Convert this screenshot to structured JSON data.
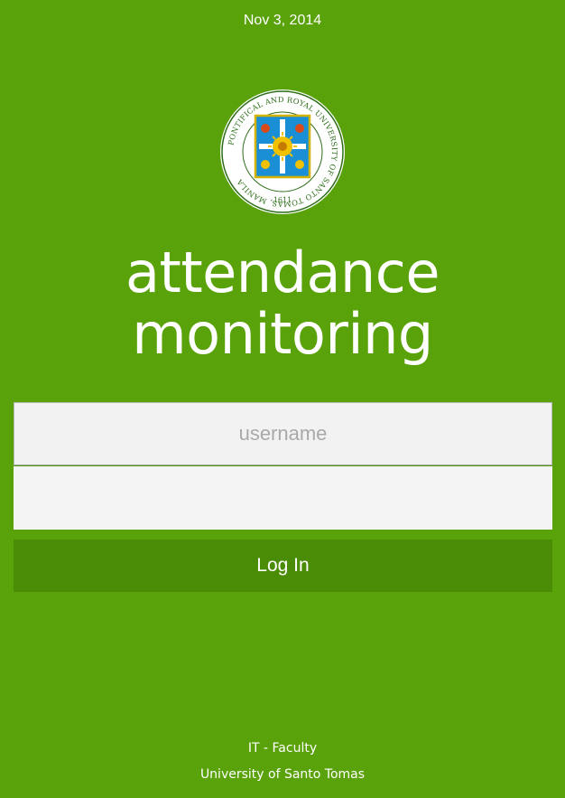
{
  "header": {
    "date": "Nov 3, 2014"
  },
  "seal": {
    "icon": "university-seal-icon",
    "ring_text": "PONTIFICAL AND ROYAL UNIVERSITY OF SANTO TOMAS, MANILA",
    "year": "1611",
    "colors": {
      "ring": "#2e6e1a",
      "shield": "#1a8fd6",
      "shield_border": "#d4b200",
      "sun": "#f2c200"
    }
  },
  "title": {
    "line1": "attendance",
    "line2": "monitoring"
  },
  "login_form": {
    "username_placeholder": "username",
    "username_value": "",
    "password_value": "",
    "login_label": "Log In"
  },
  "footer": {
    "line1": "IT - Faculty",
    "line2": "University of Santo Tomas"
  },
  "colors": {
    "background": "#5aa20a",
    "button": "#4a8c05",
    "input": "#f2f2f2"
  }
}
